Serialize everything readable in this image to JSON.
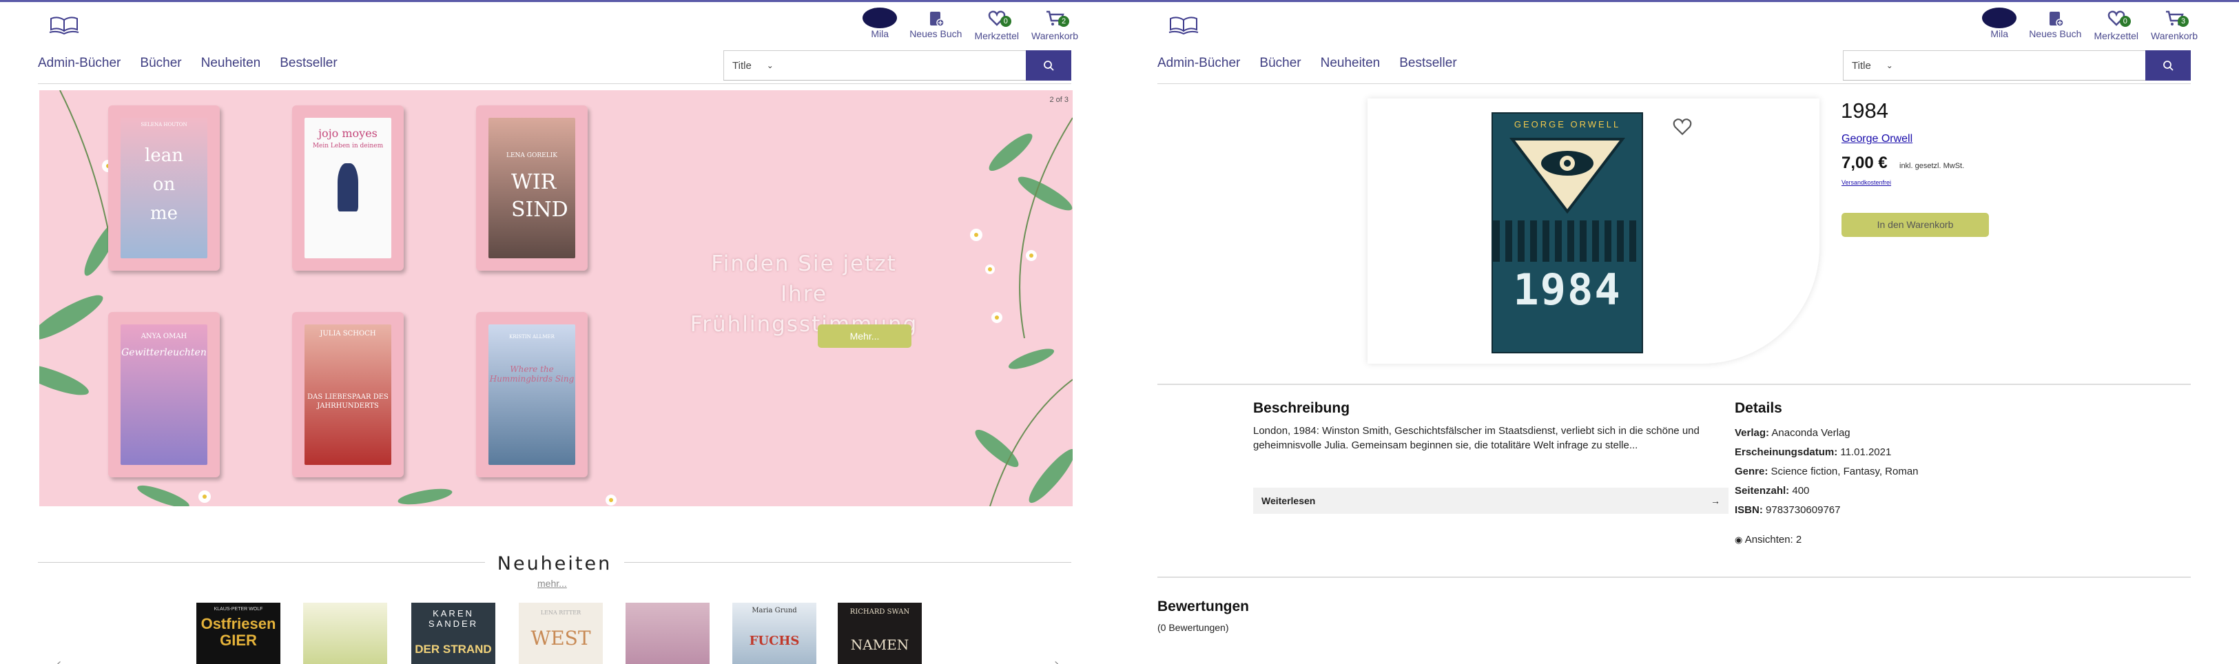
{
  "left": {
    "header": {
      "icons": [
        {
          "name": "user-avatar",
          "label": "Mila"
        },
        {
          "name": "book-plus-icon",
          "label": "Neues Buch"
        },
        {
          "name": "heart-icon",
          "label": "Merkzettel",
          "badge": "0"
        },
        {
          "name": "cart-icon",
          "label": "Warenkorb",
          "badge": "2"
        }
      ],
      "nav": [
        "Admin-Bücher",
        "Bücher",
        "Neuheiten",
        "Bestseller"
      ],
      "search": {
        "select_value": "Title",
        "placeholder": ""
      }
    },
    "hero": {
      "counter": "2 of 3",
      "headline_line1": "Finden Sie jetzt Ihre",
      "headline_line2": "Frühlingsstimmung",
      "button": "Mehr...",
      "covers": [
        {
          "author": "SELENA HOUTON",
          "title": "lean on me"
        },
        {
          "author": "jojo moyes",
          "title": "Mein Leben in deinem"
        },
        {
          "author": "LENA GORELIK",
          "title": "WIR SIND"
        },
        {
          "author": "ANYA OMAH",
          "title": "Gewitterleuchten"
        },
        {
          "author": "JULIA SCHOCH",
          "title": "DAS LIEBESPAAR DES JAHRHUNDERTS"
        },
        {
          "author": "KRISTIN ALLMER",
          "title": "Where the Hummingbirds Sing"
        }
      ]
    },
    "section": {
      "title": "Neuheiten",
      "more": "mehr...",
      "books": [
        {
          "author": "KLAUS-PETER WOLF",
          "title": "Ostfriesen GIER"
        },
        {
          "author": "",
          "title": ""
        },
        {
          "author": "KAREN SANDER",
          "title": "DER STRAND"
        },
        {
          "author": "LENA RITTER",
          "title": "WEST"
        },
        {
          "author": "",
          "title": ""
        },
        {
          "author": "Maria Grund",
          "title": "FUCHS"
        },
        {
          "author": "RICHARD SWAN",
          "title": "NAMEN"
        }
      ]
    }
  },
  "right": {
    "header": {
      "icons": [
        {
          "name": "user-avatar",
          "label": "Mila"
        },
        {
          "name": "book-plus-icon",
          "label": "Neues Buch"
        },
        {
          "name": "heart-icon",
          "label": "Merkzettel",
          "badge": "0"
        },
        {
          "name": "cart-icon",
          "label": "Warenkorb",
          "badge": "3"
        }
      ],
      "nav": [
        "Admin-Bücher",
        "Bücher",
        "Neuheiten",
        "Bestseller"
      ],
      "search": {
        "select_value": "Title",
        "placeholder": ""
      }
    },
    "product": {
      "cover_author": "GEORGE ORWELL",
      "cover_title": "1984",
      "title": "1984",
      "author": "George Orwell",
      "price": "7,00 €",
      "vat": "inkl. gesetzl. MwSt.",
      "shipping": "Versandkostenfrei",
      "cart_button": "In den Warenkorb"
    },
    "description": {
      "heading": "Beschreibung",
      "text": "London, 1984: Winston Smith, Geschichtsfälscher im Staatsdienst, verliebt sich in die schöne und geheimnisvolle Julia. Gemeinsam beginnen sie, die totalitäre Welt infrage zu stelle...",
      "read_more": "Weiterlesen"
    },
    "details": {
      "heading": "Details",
      "rows": [
        {
          "label": "Verlag:",
          "value": "Anaconda Verlag"
        },
        {
          "label": "Erscheinungsdatum:",
          "value": "11.01.2021"
        },
        {
          "label": "Genre:",
          "value": "Science fiction, Fantasy, Roman"
        },
        {
          "label": "Seitenzahl:",
          "value": "400"
        },
        {
          "label": "ISBN:",
          "value": "9783730609767"
        }
      ],
      "views": "Ansichten: 2"
    },
    "ratings": {
      "heading": "Bewertungen",
      "count": "(0 Bewertungen)"
    }
  },
  "colors": {
    "brand": "#3e3b8c",
    "nav_text": "#3f3e82",
    "hero_bg": "#f9d0d9",
    "accent_button": "#c6cb68",
    "badge": "#2b7a2b"
  }
}
